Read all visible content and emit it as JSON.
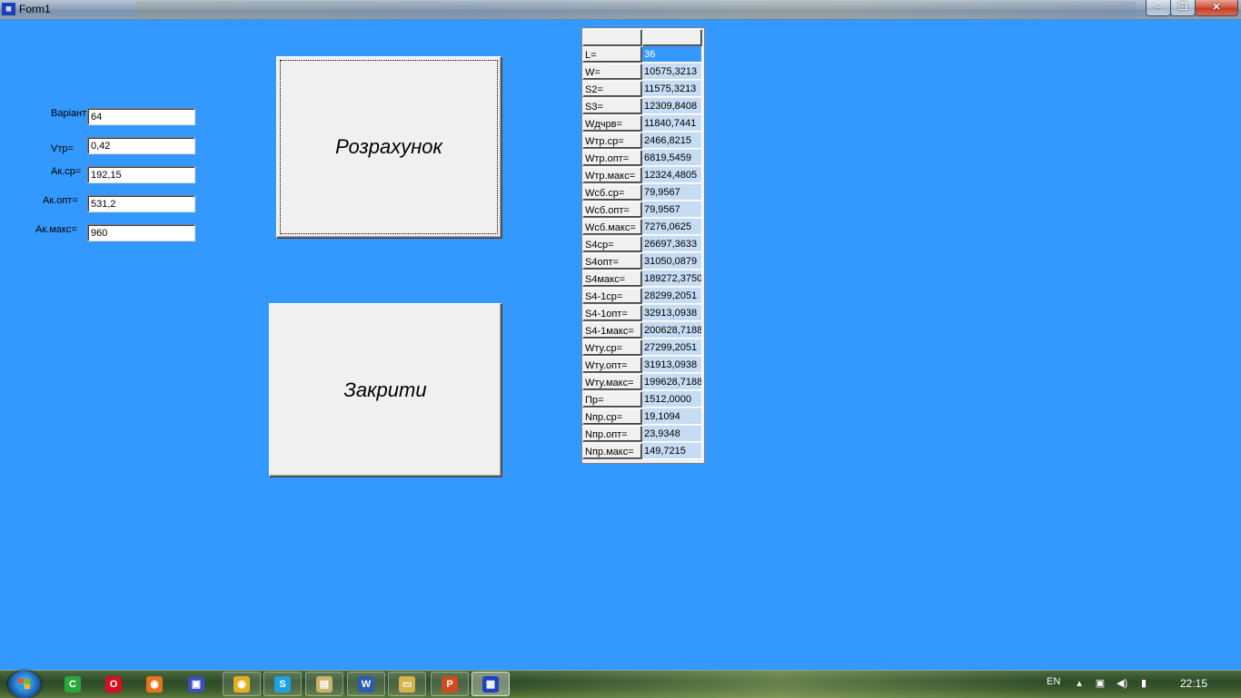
{
  "window": {
    "title": "Form1",
    "icon": "delphi-app-icon",
    "minimize": "minimize-icon",
    "maximize": "maximize-icon",
    "close": "close-icon"
  },
  "form": {
    "fields": [
      {
        "label": "Варіант",
        "value": "64"
      },
      {
        "label": "Vтр=",
        "value": "0,42"
      },
      {
        "label": "Ак.ср=",
        "value": "192,15"
      },
      {
        "label": "Ак.опт=",
        "value": "531,2"
      },
      {
        "label": "Ак.макс=",
        "value": "960"
      }
    ],
    "calc_button": "Розрахунок",
    "close_button": "Закрити"
  },
  "grid": {
    "rows": [
      {
        "name": "L=",
        "value": "36"
      },
      {
        "name": "W=",
        "value": "10575,3213"
      },
      {
        "name": "S2=",
        "value": "11575,3213"
      },
      {
        "name": "S3=",
        "value": "12309,8408"
      },
      {
        "name": "Wдчрв=",
        "value": "11840,7441"
      },
      {
        "name": "Wтр.ср=",
        "value": "2466,8215"
      },
      {
        "name": "Wтр.опт=",
        "value": "6819,5459"
      },
      {
        "name": "Wтр.макс=",
        "value": "12324,4805"
      },
      {
        "name": "Wсб.ср=",
        "value": "79,9567"
      },
      {
        "name": "Wсб.опт=",
        "value": "79,9567"
      },
      {
        "name": "Wсб.макс=",
        "value": "7276,0625"
      },
      {
        "name": "S4ср=",
        "value": "26697,3633"
      },
      {
        "name": "S4опт=",
        "value": "31050,0879"
      },
      {
        "name": "S4макс=",
        "value": "189272,3750"
      },
      {
        "name": "S4-1ср=",
        "value": "28299,2051"
      },
      {
        "name": "S4-1опт=",
        "value": "32913,0938"
      },
      {
        "name": "S4-1макс=",
        "value": "200628,7188"
      },
      {
        "name": "Wту.ср=",
        "value": "27299,2051"
      },
      {
        "name": "Wту.опт=",
        "value": "31913,0938"
      },
      {
        "name": "Wту.макс=",
        "value": "199628,7188"
      },
      {
        "name": "Пр=",
        "value": "1512,0000"
      },
      {
        "name": "Nпр.ср=",
        "value": "19,1094"
      },
      {
        "name": "Nпр.опт=",
        "value": "23,9348"
      },
      {
        "name": "Nпр.макс=",
        "value": "149,7215"
      }
    ]
  },
  "taskbar": {
    "language": "EN",
    "clock": "22:15",
    "items": [
      {
        "name": "ccleaner-icon",
        "glyph": "C",
        "color": "#2aa83a"
      },
      {
        "name": "opera-icon",
        "glyph": "O",
        "color": "#d4101e"
      },
      {
        "name": "firefox-icon",
        "glyph": "◉",
        "color": "#e8741c"
      },
      {
        "name": "save-disk-icon",
        "glyph": "▣",
        "color": "#3a4fb8"
      },
      {
        "name": "chrome-icon",
        "glyph": "◉",
        "color": "#e0b020"
      },
      {
        "name": "skype-icon",
        "glyph": "S",
        "color": "#1ea0e6"
      },
      {
        "name": "photo-viewer-icon",
        "glyph": "▤",
        "color": "#c9b46a"
      },
      {
        "name": "word-icon",
        "glyph": "W",
        "color": "#2b5cb0"
      },
      {
        "name": "explorer-icon",
        "glyph": "▭",
        "color": "#d6b34a"
      },
      {
        "name": "powerpoint-icon",
        "glyph": "P",
        "color": "#d04a20"
      },
      {
        "name": "delphi-app-icon",
        "glyph": "▦",
        "color": "#2040c0"
      }
    ]
  }
}
